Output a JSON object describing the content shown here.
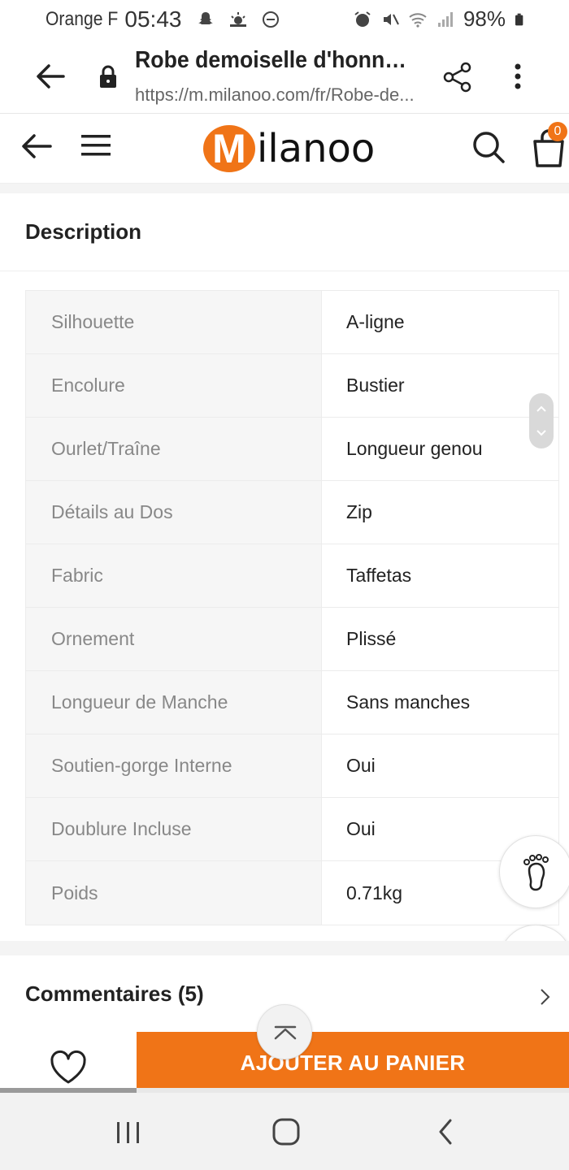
{
  "status_bar": {
    "carrier": "Orange F",
    "time": "05:43",
    "battery": "98%"
  },
  "browser": {
    "title": "Robe demoiselle d'honneu...",
    "url": "https://m.milanoo.com/fr/Robe-de..."
  },
  "site": {
    "logo_initial": "M",
    "logo_rest": "ilanoo",
    "cart_count": "0"
  },
  "description": {
    "title": "Description",
    "rows": [
      {
        "key": "Silhouette",
        "value": "A-ligne"
      },
      {
        "key": "Encolure",
        "value": "Bustier"
      },
      {
        "key": "Ourlet/Traîne",
        "value": "Longueur genou"
      },
      {
        "key": "Détails au Dos",
        "value": "Zip"
      },
      {
        "key": "Fabric",
        "value": "Taffetas"
      },
      {
        "key": "Ornement",
        "value": "Plissé"
      },
      {
        "key": "Longueur de Manche",
        "value": "Sans manches"
      },
      {
        "key": "Soutien-gorge Interne",
        "value": "Oui"
      },
      {
        "key": "Doublure Incluse",
        "value": "Oui"
      },
      {
        "key": "Poids",
        "value": "0.71kg"
      }
    ]
  },
  "comments": {
    "title": "Commentaires (5)"
  },
  "actions": {
    "add_to_cart": "AJOUTER AU PANIER"
  },
  "scroll_progress": 0.24,
  "colors": {
    "brand": "#f07417",
    "key_bg": "#f6f6f6"
  },
  "icons": {
    "status_left": [
      "snapchat-ghost-icon",
      "weather-icon",
      "do-not-disturb-icon"
    ],
    "status_right": [
      "alarm-icon",
      "mute-icon",
      "wifi-icon",
      "signal-icon",
      "battery-icon"
    ]
  }
}
